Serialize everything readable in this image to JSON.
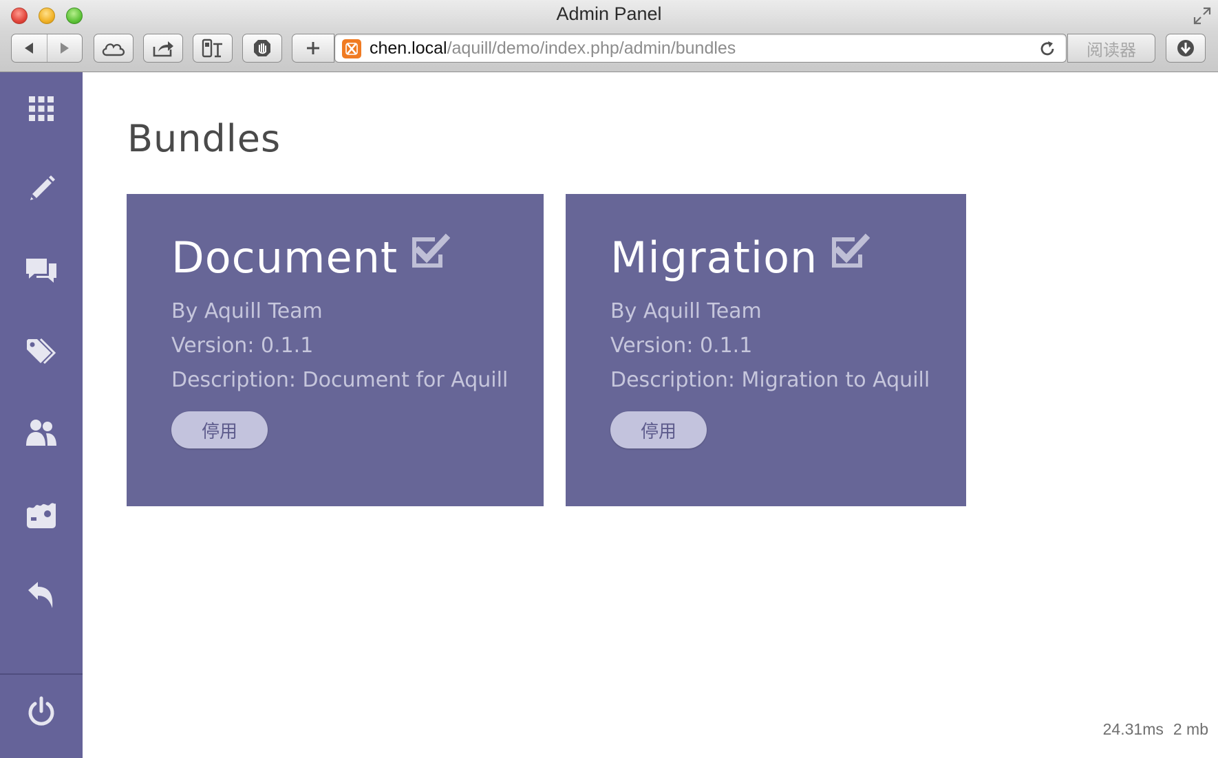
{
  "window": {
    "title": "Admin Panel"
  },
  "toolbar": {
    "back_icon": "arrow-left-icon",
    "forward_icon": "arrow-right-icon",
    "icloud_icon": "cloud-icon",
    "share_icon": "share-icon",
    "extension_icon": "extension-icon",
    "hand_icon": "hand-icon",
    "new_tab_icon": "plus-icon",
    "url_host": "chen.local",
    "url_path": "/aquill/demo/index.php/admin/bundles",
    "reader_label": "阅读器",
    "download_icon": "download-icon"
  },
  "sidebar": {
    "items": [
      {
        "icon": "grid-icon"
      },
      {
        "icon": "pencil-icon"
      },
      {
        "icon": "comments-icon"
      },
      {
        "icon": "tags-icon"
      },
      {
        "icon": "users-icon"
      },
      {
        "icon": "image-icon"
      },
      {
        "icon": "undo-icon"
      }
    ],
    "footer_icon": "power-icon"
  },
  "page": {
    "title": "Bundles"
  },
  "bundles": [
    {
      "name": "Document",
      "enabled_icon": "checkbox-checked-icon",
      "author": "By Aquill Team",
      "version": "Version: 0.1.1",
      "description": "Description: Document for Aquill",
      "action_label": "停用"
    },
    {
      "name": "Migration",
      "enabled_icon": "checkbox-checked-icon",
      "author": "By Aquill Team",
      "version": "Version: 0.1.1",
      "description": "Description: Migration to Aquill",
      "action_label": "停用"
    }
  ],
  "footer": {
    "time": "24.31ms",
    "memory": "2 mb"
  },
  "colors": {
    "sidebar": "#656399",
    "card": "#676697",
    "pill": "#c3c3dd",
    "meta_text": "#c6c6dc"
  }
}
